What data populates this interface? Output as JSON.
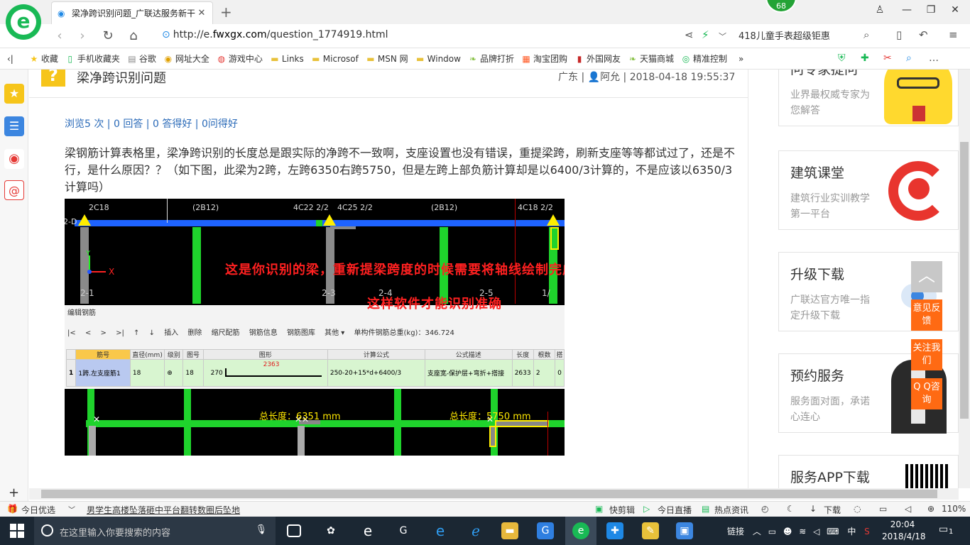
{
  "browser": {
    "tab_title": "梁净跨识别问题_广联达服务新干",
    "badge_count": "68",
    "url_prefix": "http://e.",
    "url_domain": "fwxgx.com",
    "url_path": "/question_1774919.html",
    "search_text": "418儿童手表超级钜惠"
  },
  "bookmarks": [
    {
      "label": "收藏",
      "icon": "star-icon"
    },
    {
      "label": "手机收藏夹",
      "icon": "phone-icon"
    },
    {
      "label": "谷歌",
      "icon": "page-icon"
    },
    {
      "label": "网址大全",
      "icon": "globe-icon"
    },
    {
      "label": "游戏中心",
      "icon": "game-icon"
    },
    {
      "label": "Links",
      "icon": "folder-icon"
    },
    {
      "label": "Microsof",
      "icon": "folder-icon"
    },
    {
      "label": "MSN 网",
      "icon": "folder-icon"
    },
    {
      "label": "Window",
      "icon": "folder-icon"
    },
    {
      "label": "品牌打折",
      "icon": "leaf-icon"
    },
    {
      "label": "淘宝团购",
      "icon": "taobao-icon"
    },
    {
      "label": "外国网友",
      "icon": "flag-icon"
    },
    {
      "label": "天猫商城",
      "icon": "leaf-icon"
    },
    {
      "label": "精准控制",
      "icon": "wechat-icon"
    }
  ],
  "question": {
    "title": "梁净跨识别问题",
    "region": "广东",
    "author": "阿允",
    "datetime": "2018-04-18 19:55:37",
    "stats": {
      "views": "浏览5 次",
      "answers": "0 回答",
      "score": "0 答得好",
      "asked": "0问得好"
    },
    "body": "梁钢筋计算表格里，梁净跨识别的长度总是跟实际的净跨不一致啊，支座设置也没有错误，重提梁跨，刷新支座等等都试过了，还是不行，是什么原因？？（如下图，此梁为2跨，左跨6350右跨5750，但是左跨上部负筋计算却是以6400/3计算的，不是应该以6350/3计算吗）"
  },
  "screenshot": {
    "top_labels": [
      "2C18",
      "(2B12)",
      "4C22 2/2",
      "4C25 2/2",
      "(2B12)",
      "4C18 2/2"
    ],
    "left_label": "2-D",
    "axis_x": "X",
    "axis_y": "Y",
    "annotation_1": "这是你识别的梁，重新提梁跨度的时候需要将轴线绘制完成",
    "annotation_2": "这样软件才能识别准确",
    "bottom_labels": [
      "2-1",
      "2-3",
      "2-4",
      "2-5",
      "1/"
    ],
    "editor_title": "编辑钢筋",
    "toolbar": [
      "|<",
      "<",
      ">",
      ">|",
      "↑",
      "↓",
      "插入",
      "删除",
      "缩尺配筋",
      "钢筋信息",
      "钢筋图库",
      "其他 ▾",
      "单构件钢筋总重(kg)：346.724"
    ],
    "table_headers": [
      "",
      "筋号",
      "直径(mm)",
      "级别",
      "图号",
      "图形",
      "计算公式",
      "公式描述",
      "长度",
      "根数",
      "搭"
    ],
    "table_row": [
      "1",
      "1跨.左支座筋1",
      "18",
      "⊕",
      "18",
      "270",
      "2363",
      "250-20+15*d+6400/3",
      "支座宽-保护层+弯折+搭接",
      "2633",
      "2",
      "0"
    ],
    "total_length_1": "总长度：6351 mm",
    "total_length_2": "总长度：5750 mm"
  },
  "right_cards": [
    {
      "title": "问专家提问",
      "sub": "业界最权威专家为您解答"
    },
    {
      "title": "建筑课堂",
      "sub": "建筑行业实训教学第一平台"
    },
    {
      "title": "升级下载",
      "sub": "广联达官方唯一指定升级下载"
    },
    {
      "title": "预约服务",
      "sub": "服务面对面，承诺心连心"
    },
    {
      "title": "服务APP下载",
      "sub": ""
    }
  ],
  "float_buttons": [
    {
      "label": "意见反馈"
    },
    {
      "label": "关注我们"
    },
    {
      "label": "Q Q咨询"
    }
  ],
  "statusbar": {
    "today": "今日优选",
    "news": "男学生高楼坠落砸中平台翻转数圈后坠地",
    "quick_cut": "快剪辑",
    "live": "今日直播",
    "hot": "热点资讯",
    "download": "下载",
    "zoom": "110%"
  },
  "taskbar": {
    "search_placeholder": "在这里输入你要搜索的内容",
    "tray_link": "链接",
    "ime": "中",
    "time": "20:04",
    "date": "2018/4/18",
    "notif": "1"
  },
  "colors": {
    "accent_green": "#19b955",
    "link_blue": "#2a6ab8",
    "orange": "#ff6a13",
    "question_yellow": "#f6c51a"
  }
}
